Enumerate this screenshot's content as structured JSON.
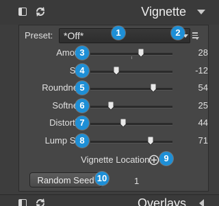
{
  "panel": {
    "title": "Vignette",
    "toggle_icon": "panel-toggle-icon",
    "reset_icon": "reset-icon"
  },
  "preset": {
    "label": "Preset:",
    "value": "*Off*"
  },
  "sliders": [
    {
      "label": "Amount",
      "value": "28",
      "fraction": 0.62
    },
    {
      "label": "Size",
      "value": "-12",
      "fraction": 0.32
    },
    {
      "label": "Roundness",
      "value": "54",
      "fraction": 0.77
    },
    {
      "label": "Softness",
      "value": "25",
      "fraction": 0.25
    },
    {
      "label": "Distortion",
      "value": "44",
      "fraction": 0.4
    },
    {
      "label": "Lump Size",
      "value": "71",
      "fraction": 0.73
    }
  ],
  "vignette_location": {
    "label": "Vignette Location:",
    "icon": "target-add-icon"
  },
  "random_seed": {
    "button_label": "Random Seed",
    "value": "1"
  },
  "callouts": [
    "1",
    "2",
    "3",
    "4",
    "5",
    "6",
    "7",
    "8",
    "9",
    "10"
  ],
  "next_panel": {
    "title": "Overlays"
  },
  "colors": {
    "background": "#3d3d3d",
    "panel": "#464646",
    "callout": "#1e8fd6",
    "text": "#e0e0e0"
  }
}
